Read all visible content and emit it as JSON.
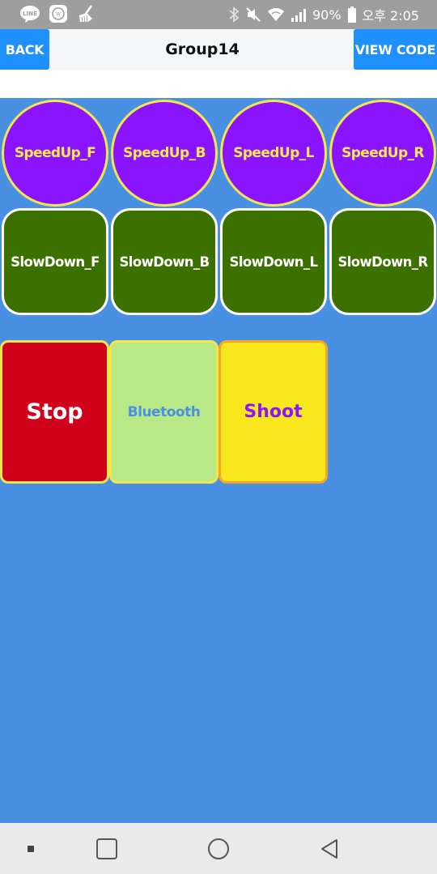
{
  "status_bar": {
    "battery_text": "90%",
    "time_text": "오후 2:05",
    "left_icons": [
      "line-app-icon",
      "cloud-notification-icon",
      "broom-cleaner-icon"
    ],
    "right_icons": [
      "bluetooth-icon",
      "mute-icon",
      "wifi-icon",
      "signal-icon",
      "battery-icon"
    ]
  },
  "app_bar": {
    "back_label": "BACK",
    "title": "Group14",
    "view_code_label": "VIEW CODE",
    "accent_color": "#1e90ff"
  },
  "canvas": {
    "background_color": "#4a90e2",
    "speed_up_buttons": [
      {
        "label": "SpeedUp_F"
      },
      {
        "label": "SpeedUp_B"
      },
      {
        "label": "SpeedUp_L"
      },
      {
        "label": "SpeedUp_R"
      }
    ],
    "slow_down_buttons": [
      {
        "label": "SlowDown_F"
      },
      {
        "label": "SlowDown_B"
      },
      {
        "label": "SlowDown_L"
      },
      {
        "label": "SlowDown_R"
      }
    ],
    "stop_label": "Stop",
    "bluetooth_label": "Bluetooth",
    "shoot_label": "Shoot",
    "colors": {
      "speed_up": "#8a14ff",
      "slow_down": "#3c7100",
      "stop": "#d0021b",
      "bluetooth": "#b8e986",
      "shoot": "#f8e71c"
    }
  },
  "nav_bar": {
    "icons": [
      "recent-apps-dot-icon",
      "overview-square-icon",
      "home-circle-icon",
      "back-triangle-icon"
    ]
  }
}
